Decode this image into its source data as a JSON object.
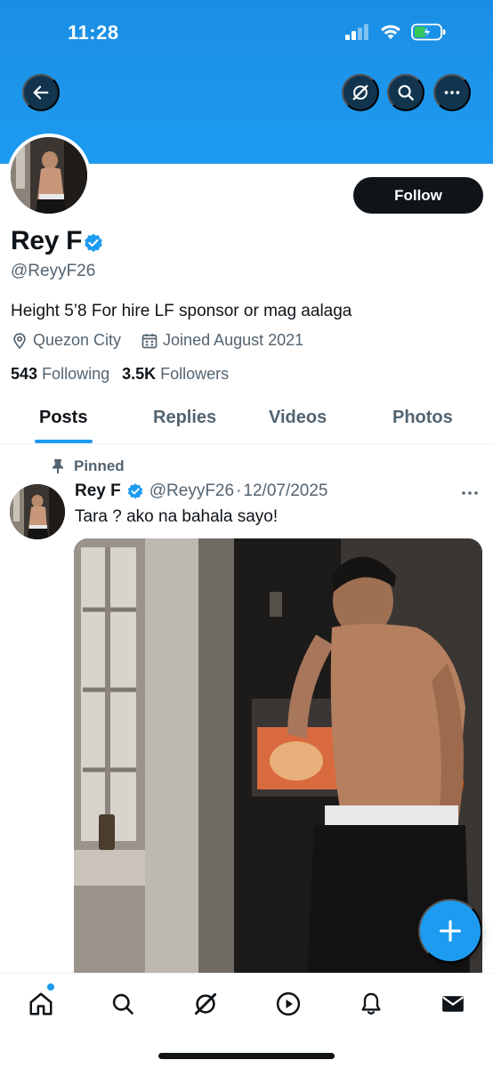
{
  "status_bar": {
    "time": "11:28"
  },
  "profile": {
    "display_name": "Rey F",
    "handle": "@ReyyF26",
    "bio": "Height 5’8 For hire LF sponsor or mag aalaga",
    "location": "Quezon City",
    "joined": "Joined August 2021",
    "following_count": "543",
    "following_label": "Following",
    "followers_count": "3.5K",
    "followers_label": "Followers",
    "follow_label": "Follow"
  },
  "tabs": [
    {
      "label": "Posts",
      "active": true
    },
    {
      "label": "Replies",
      "active": false
    },
    {
      "label": "Videos",
      "active": false
    },
    {
      "label": "Photos",
      "active": false
    }
  ],
  "pinned_post": {
    "pinned_label": "Pinned",
    "author_name": "Rey F",
    "author_handle": "@ReyyF26",
    "separator": "·",
    "date": "12/07/2025",
    "text": "Tara ? ako na bahala sayo!"
  },
  "top_actions": [
    "back-arrow-icon",
    "grok-icon",
    "search-icon",
    "more-icon"
  ],
  "bottom_nav": [
    "home-icon",
    "search-icon",
    "grok-icon",
    "video-icon",
    "notifications-icon",
    "messages-icon"
  ],
  "colors": {
    "accent": "#1d9bf0",
    "text": "#0f1419",
    "muted": "#536471",
    "banner": "#1d9bf0"
  }
}
